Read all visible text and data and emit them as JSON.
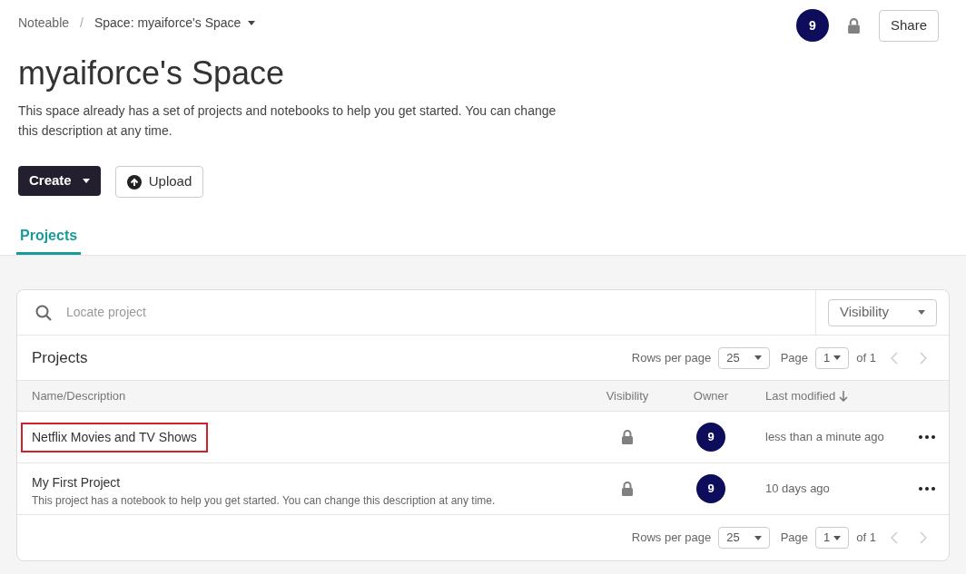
{
  "breadcrumb_separator": "/",
  "breadcrumb": [
    {
      "label": "Noteable",
      "dropdown": false
    },
    {
      "label": "Space: myaiforce's Space",
      "dropdown": true
    }
  ],
  "header": {
    "avatar": "9",
    "share": "Share"
  },
  "title": "myaiforce's Space",
  "description": "This space already has a set of projects and notebooks to help you get started. You can change this description at any time.",
  "actions": [
    {
      "kind": "create",
      "label": "Create"
    },
    {
      "kind": "upload",
      "label": "Upload"
    }
  ],
  "tabs": [
    {
      "label": "Projects",
      "selected": true
    }
  ],
  "search": {
    "placeholder": "Locate project"
  },
  "visibility_filter": "Visibility",
  "panel_title": "Projects",
  "pagination_top": {
    "rows_label": "Rows per page",
    "rows": "25",
    "page_label": "Page",
    "page": "1",
    "of": "of 1"
  },
  "table": {
    "columns": [
      "Name/Description",
      "Visibility",
      "Owner",
      "Last modified"
    ],
    "rows": [
      {
        "name": "Netflix Movies and TV Shows",
        "highlighted": true,
        "private": true,
        "owner": "9",
        "modified": "less than a minute ago"
      },
      {
        "name": "My First Project",
        "description": "This project has a notebook to help you get started. You can change this description at any time.",
        "highlighted": false,
        "private": true,
        "owner": "9",
        "modified": "10 days ago"
      }
    ]
  },
  "pagination_bottom": {
    "rows_label": "Rows per page",
    "rows": "25",
    "page_label": "Page",
    "page": "1",
    "of": "of 1"
  }
}
